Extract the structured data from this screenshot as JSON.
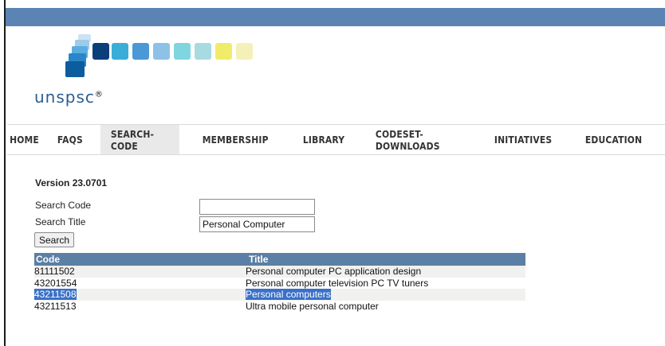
{
  "logo": {
    "text": "unspsc",
    "mark": "®",
    "squares": [
      "#0a4a8a",
      "#3aaed8",
      "#4aa0d8",
      "#8ec1e8",
      "#7fd6e0",
      "#a8dbe0",
      "#f0ec6a",
      "#f4f0b8"
    ]
  },
  "nav": [
    "HOME",
    "FAQS",
    "SEARCH-CODE",
    "MEMBERSHIP",
    "LIBRARY",
    "CODESET-DOWNLOADS",
    "INITIATIVES",
    "EDUCATION"
  ],
  "nav_active": "SEARCH-CODE",
  "version": "Version 23.0701",
  "search": {
    "code_label": "Search Code",
    "code_value": "",
    "title_label": "Search Title",
    "title_value": "Personal Computer",
    "button": "Search"
  },
  "results": {
    "headers": {
      "code": "Code",
      "title": "Title"
    },
    "rows": [
      {
        "code": "81111502",
        "title": "Personal computer PC application design"
      },
      {
        "code": "43201554",
        "title": "Personal computer television PC TV tuners"
      },
      {
        "code": "43211508",
        "title": "Personal computers"
      },
      {
        "code": "43211513",
        "title": "Ultra mobile personal computer"
      }
    ]
  }
}
